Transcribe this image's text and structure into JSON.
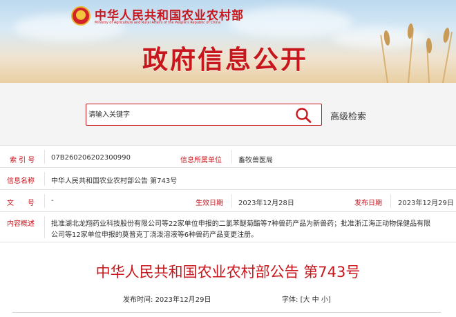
{
  "header": {
    "ministry_cn": "中华人民共和国农业农村部",
    "ministry_en": "Ministry of Agriculture and Rural Affairs of the People's Republic of China",
    "banner_title": "政府信息公开",
    "brand_color": "#c8161d"
  },
  "search": {
    "placeholder": "请输入关键字",
    "advanced_label": "高级检索",
    "icon": "search-icon"
  },
  "info": {
    "index_label": "索 引 号",
    "index_value": "07B260206202300990",
    "org_label": "信息所属单位",
    "org_value": "畜牧兽医局",
    "name_label": "信息名称",
    "name_value": "中华人民共和国农业农村部公告 第743号",
    "docno_label": "文　　号",
    "docno_value": "-",
    "effective_label": "生效日期",
    "effective_value": "2023年12月28日",
    "publish_label": "发布日期",
    "publish_value": "2023年12月29日",
    "summary_label": "内容概述",
    "summary_line1": "批准湖北龙翔药业科技股份有限公司等22家单位申报的二氯苯醚菊酯等7种兽药产品为新兽药；批准浙江海正动物保健品有限",
    "summary_line2": "公司等12家单位申报的莫普克丁浇泼溶液等6种兽药产品变更注册。"
  },
  "document": {
    "title": "中华人民共和国农业农村部公告 第743号",
    "publish_time_label": "发布时间:",
    "publish_time_value": "2023年12月29日",
    "font_label": "字体:",
    "font_open": "[",
    "font_large": "大",
    "font_medium": "中",
    "font_small": "小",
    "font_close": "]"
  }
}
